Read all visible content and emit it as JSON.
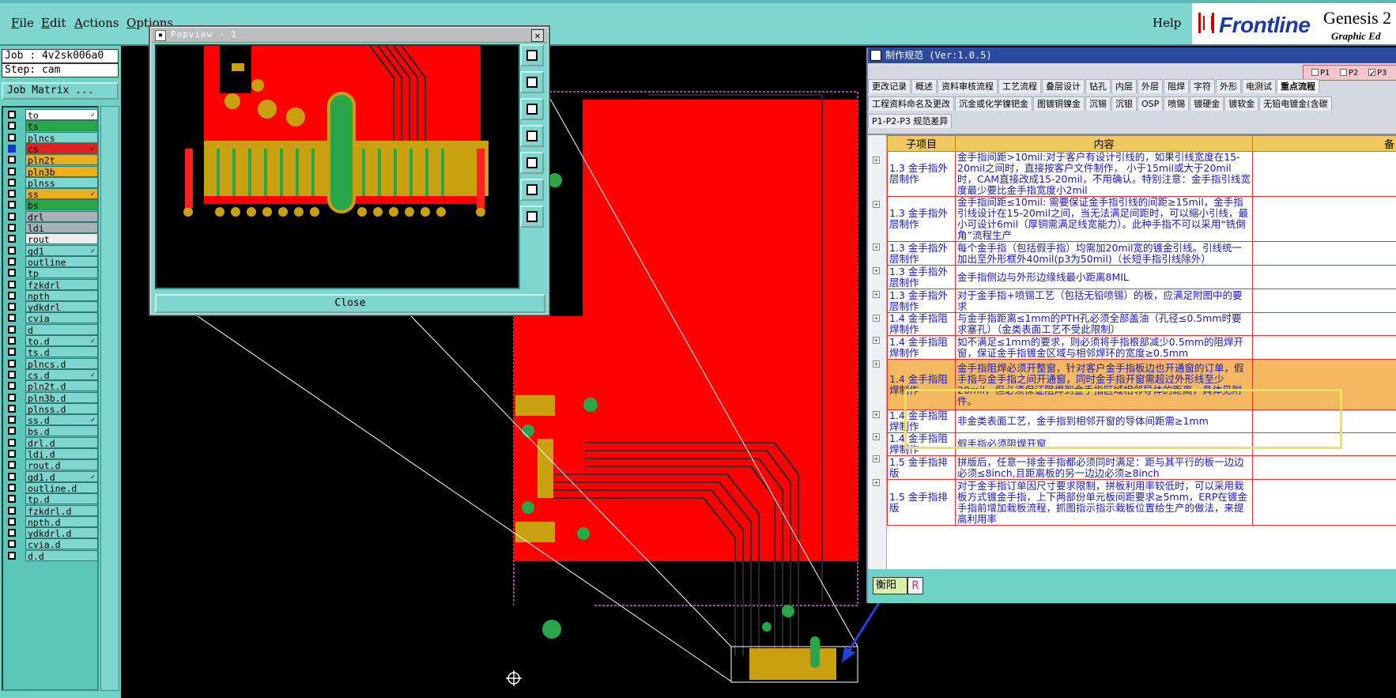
{
  "menu": {
    "items": [
      {
        "label": "File",
        "ul": "F",
        "rest": "ile"
      },
      {
        "label": "Edit",
        "ul": "E",
        "rest": "dit"
      },
      {
        "label": "Actions",
        "ul": "A",
        "rest": "ctions"
      },
      {
        "label": "Options",
        "ul": "O",
        "rest": "ptions"
      }
    ],
    "help": "Help"
  },
  "logo": {
    "brand": "Frontline",
    "product": "Genesis 2",
    "tagline": "Graphic Ed"
  },
  "job": {
    "job_label": "Job : 4v2sk006a0",
    "step_label": "Step: cam",
    "matrix_button": "Job Matrix ..."
  },
  "layers": [
    {
      "name": "to",
      "color": "#ffffff",
      "on": false,
      "tick": true
    },
    {
      "name": "ts",
      "color": "#2aa64a",
      "on": false,
      "tick": false
    },
    {
      "name": "plncs",
      "color": "#7fd6cf",
      "on": false,
      "tick": false
    },
    {
      "name": "cs",
      "color": "#e02020",
      "on": true,
      "tick": true
    },
    {
      "name": "pln2t",
      "color": "#e8b020",
      "on": false,
      "tick": false
    },
    {
      "name": "pln3b",
      "color": "#e8b020",
      "on": false,
      "tick": false
    },
    {
      "name": "plnss",
      "color": "#7fd6cf",
      "on": false,
      "tick": false
    },
    {
      "name": "ss",
      "color": "#e8b020",
      "on": false,
      "tick": true
    },
    {
      "name": "bs",
      "color": "#2aa64a",
      "on": false,
      "tick": false
    },
    {
      "name": "drl",
      "color": "#a8b0b8",
      "on": false,
      "tick": false
    },
    {
      "name": "ldi",
      "color": "#a8b0b8",
      "on": false,
      "tick": false
    },
    {
      "name": "rout",
      "color": "#ededed",
      "on": false,
      "tick": false
    },
    {
      "name": "gd1",
      "color": "#7fd6cf",
      "on": false,
      "tick": true
    },
    {
      "name": "outline",
      "color": "#7fd6cf",
      "on": false,
      "tick": false
    },
    {
      "name": "tp",
      "color": "#7fd6cf",
      "on": false,
      "tick": false
    },
    {
      "name": "fzkdrl",
      "color": "#7fd6cf",
      "on": false,
      "tick": false
    },
    {
      "name": "npth",
      "color": "#7fd6cf",
      "on": false,
      "tick": false
    },
    {
      "name": "ydkdrl",
      "color": "#7fd6cf",
      "on": false,
      "tick": false
    },
    {
      "name": "cvia",
      "color": "#7fd6cf",
      "on": false,
      "tick": false
    },
    {
      "name": "d",
      "color": "#7fd6cf",
      "on": false,
      "tick": false
    },
    {
      "name": "to.d",
      "color": "#7fd6cf",
      "on": false,
      "tick": true
    },
    {
      "name": "ts.d",
      "color": "#7fd6cf",
      "on": false,
      "tick": false
    },
    {
      "name": "plncs.d",
      "color": "#7fd6cf",
      "on": false,
      "tick": false
    },
    {
      "name": "cs.d",
      "color": "#7fd6cf",
      "on": false,
      "tick": true
    },
    {
      "name": "pln2t.d",
      "color": "#7fd6cf",
      "on": false,
      "tick": false
    },
    {
      "name": "pln3b.d",
      "color": "#7fd6cf",
      "on": false,
      "tick": false
    },
    {
      "name": "plnss.d",
      "color": "#7fd6cf",
      "on": false,
      "tick": false
    },
    {
      "name": "ss.d",
      "color": "#7fd6cf",
      "on": false,
      "tick": true
    },
    {
      "name": "bs.d",
      "color": "#7fd6cf",
      "on": false,
      "tick": false
    },
    {
      "name": "drl.d",
      "color": "#7fd6cf",
      "on": false,
      "tick": false
    },
    {
      "name": "ldi.d",
      "color": "#7fd6cf",
      "on": false,
      "tick": false
    },
    {
      "name": "rout.d",
      "color": "#7fd6cf",
      "on": false,
      "tick": false
    },
    {
      "name": "gd1.d",
      "color": "#7fd6cf",
      "on": false,
      "tick": true
    },
    {
      "name": "outline.d",
      "color": "#7fd6cf",
      "on": false,
      "tick": false
    },
    {
      "name": "tp.d",
      "color": "#7fd6cf",
      "on": false,
      "tick": false
    },
    {
      "name": "fzkdrl.d",
      "color": "#7fd6cf",
      "on": false,
      "tick": false
    },
    {
      "name": "npth.d",
      "color": "#7fd6cf",
      "on": false,
      "tick": false
    },
    {
      "name": "ydkdrl.d",
      "color": "#7fd6cf",
      "on": false,
      "tick": false
    },
    {
      "name": "cvia.d",
      "color": "#7fd6cf",
      "on": false,
      "tick": false
    },
    {
      "name": "d.d",
      "color": "#7fd6cf",
      "on": false,
      "tick": false
    }
  ],
  "popview": {
    "title": "Popview - 1",
    "close_button": "Close"
  },
  "spec": {
    "title": "制作规范 (Ver:1.0.5)",
    "filters": [
      "P1",
      "P2",
      "P3"
    ],
    "tabs_row1": [
      "更改记录",
      "概述",
      "资料审核流程",
      "工艺流程",
      "叠层设计",
      "钻孔",
      "内层",
      "外层",
      "阻焊",
      "字符",
      "外形",
      "电测试",
      "重点流程"
    ],
    "tabs_row2": [
      "工程资料命名及更改",
      "沉金或化学镍钯金",
      "图镀铜镍金",
      "沉锡",
      "沉银",
      "OSP",
      "喷锡",
      "镀硬金",
      "镀软金",
      "无铅电镀金(含碳"
    ],
    "tabs_row3": [
      "P1-P2-P3 规范差异"
    ],
    "columns": [
      "子项目",
      "内容",
      "备"
    ],
    "rows": [
      {
        "sub": "1.3 金手指外层制作",
        "content": "金手指间距>10mil:对于客户有设计引线的，如果引线宽度在15-20mil之间时，直接按客户文件制作， 小于15mil或大于20mil时，CAM直接改成15-20mil，不用确认。特别注意：金手指引线宽度最少要比金手指宽度小2mil"
      },
      {
        "sub": "1.3 金手指外层制作",
        "content": "金手指间距≤10mil: 需要保证金手指引线的间距≥15mil，金手指引线设计在15-20mil之间，当无法满足间距时，可以缩小引线，最小可设计6mil（厚铜需满足线宽能力）。此种手指不可以采用“铣倒角”流程生产"
      },
      {
        "sub": "1.3 金手指外层制作",
        "content": "每个金手指（包括假手指）均需加20mil宽的镀金引线。引线统一加出至外形框外40mil(p3为50mil)（长短手指引线除外）"
      },
      {
        "sub": "1.3 金手指外层制作",
        "content": "金手指侧边与外形边缘线最小距离8MIL"
      },
      {
        "sub": "1.3 金手指外层制作",
        "content": "对于金手指+喷锡工艺（包括无铅喷锡）的板，应满足附图中的要求"
      },
      {
        "sub": "1.4 金手指阻焊制作",
        "content": "与金手指距离≤1mm的PTH孔必须全部盖油（孔径≤0.5mm时要求塞孔）（金类表面工艺不受此限制）"
      },
      {
        "sub": "1.4 金手指阻焊制作",
        "content": "如不满足≤1mm的要求，则必须将手指根部减少0.5mm的阻焊开窗，保证金手指镀金区域与相邻焊环的宽度≥0.5mm"
      },
      {
        "sub": "1.4 金手指阻焊制作",
        "content": "金手指阻焊必须开整窗，针对客户金手指板边也开通窗的订单，假手指与金手指之间开通窗，同时金手指开窗需超过外形线至少20mil，但必须保证阻焊到金手指区域相邻导体的距离，具体见附件。"
      },
      {
        "sub": "1.4 金手指阻焊制作",
        "content": "非金类表面工艺，金手指到相邻开窗的导体间距需≥1mm"
      },
      {
        "sub": "1.4 金手指阻焊制作",
        "content": "假手指必须阻焊开窗"
      },
      {
        "sub": "1.5 金手指排版",
        "content": "拼版后，任意一排金手指都必须同时满足：距与其平行的板一边边必须≤8inch,且距离板的另一边边必须≥8inch"
      },
      {
        "sub": "1.5 金手指排版",
        "content": "对于金手指订单因尺寸要求限制，拼板利用率较低时，可以采用栽板方式镀金手指，上下两部份单元板间距要求≥5mm，ERP在镀金手指前增加栽板流程，抓图指示指示栽板位置给生产的做法，来提高利用率"
      }
    ],
    "status_label": "衡阳",
    "status_r": "R"
  }
}
